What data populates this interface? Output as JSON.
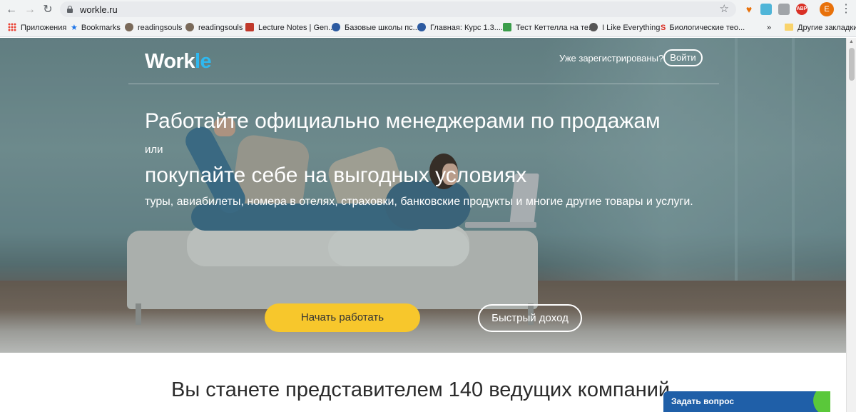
{
  "browser": {
    "url": "workle.ru",
    "profile_initial": "E",
    "extensions": [
      {
        "name": "heart-extension",
        "label": "",
        "color": "#e8710a"
      },
      {
        "name": "translate-extension",
        "label": "",
        "color": "#4fb5d8"
      },
      {
        "name": "image-extension",
        "label": "",
        "color": "#a0a4a8"
      },
      {
        "name": "adblock-extension",
        "label": "ABP",
        "color": "#d93025"
      }
    ]
  },
  "bookmarks": {
    "items": [
      {
        "label": "Приложения",
        "icon": "apps-grid-icon"
      },
      {
        "label": "Bookmarks",
        "icon": "star-icon"
      },
      {
        "label": "readingsouls",
        "icon": "user-icon"
      },
      {
        "label": "readingsouls",
        "icon": "user-icon"
      },
      {
        "label": "Lecture Notes | Gen...",
        "icon": "lecture-notes-icon"
      },
      {
        "label": "Базовые школы пс...",
        "icon": "globe-icon"
      },
      {
        "label": "Главная: Курс 1.3....",
        "icon": "globe-icon"
      },
      {
        "label": "Тест Кеттелла на те...",
        "icon": "check-icon"
      },
      {
        "label": "I Like Everything",
        "icon": "globe-icon"
      },
      {
        "label": "Биологические тео...",
        "icon": "s-logo-icon"
      }
    ],
    "overflow": "»",
    "other": "Другие закладки"
  },
  "header": {
    "logo_main": "Work",
    "logo_accent": "le",
    "already_registered": "Уже зарегистрированы?",
    "login": "Войти"
  },
  "hero": {
    "headline1": "Работайте официально менеджерами по продажам",
    "or": "или",
    "headline2": "покупайте себе на выгодных условиях",
    "subtext": "туры, авиабилеты, номера в отелях, страховки, банковские продукты и многие другие товары и услуги.",
    "start_button": "Начать работать",
    "fast_income_button": "Быстрый доход"
  },
  "section": {
    "companies_title": "Вы станете представителем 140 ведущих компаний"
  },
  "widget": {
    "ask_question": "Задать вопрос"
  },
  "colors": {
    "accent_yellow": "#f7c72c",
    "logo_blue": "#2fb8ef",
    "widget_blue": "#1f5fa8",
    "widget_green": "#5ac83a"
  }
}
